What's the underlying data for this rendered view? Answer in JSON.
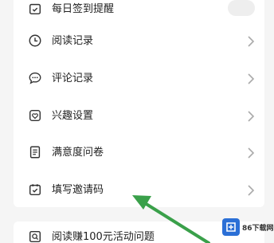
{
  "menu": {
    "items": [
      {
        "label": "每日签到提醒",
        "icon": "calendar-check-icon",
        "trailing": "toggle"
      },
      {
        "label": "阅读记录",
        "icon": "clock-icon",
        "trailing": "chevron"
      },
      {
        "label": "评论记录",
        "icon": "comment-icon",
        "trailing": "chevron"
      },
      {
        "label": "兴趣设置",
        "icon": "heart-icon",
        "trailing": "chevron"
      },
      {
        "label": "满意度问卷",
        "icon": "document-icon",
        "trailing": "chevron"
      },
      {
        "label": "填写邀请码",
        "icon": "calendar-check-icon",
        "trailing": "chevron"
      }
    ]
  },
  "bottom_item": {
    "label": "阅读赚100元活动问题",
    "icon": "search-icon"
  },
  "watermark": {
    "text": "86下载网"
  },
  "colors": {
    "background": "#f5f5f5",
    "card": "#ffffff",
    "text": "#222222",
    "chevron": "#aaaaaa",
    "arrow": "#3aa04a",
    "watermark_logo": "#2b6fd6"
  }
}
